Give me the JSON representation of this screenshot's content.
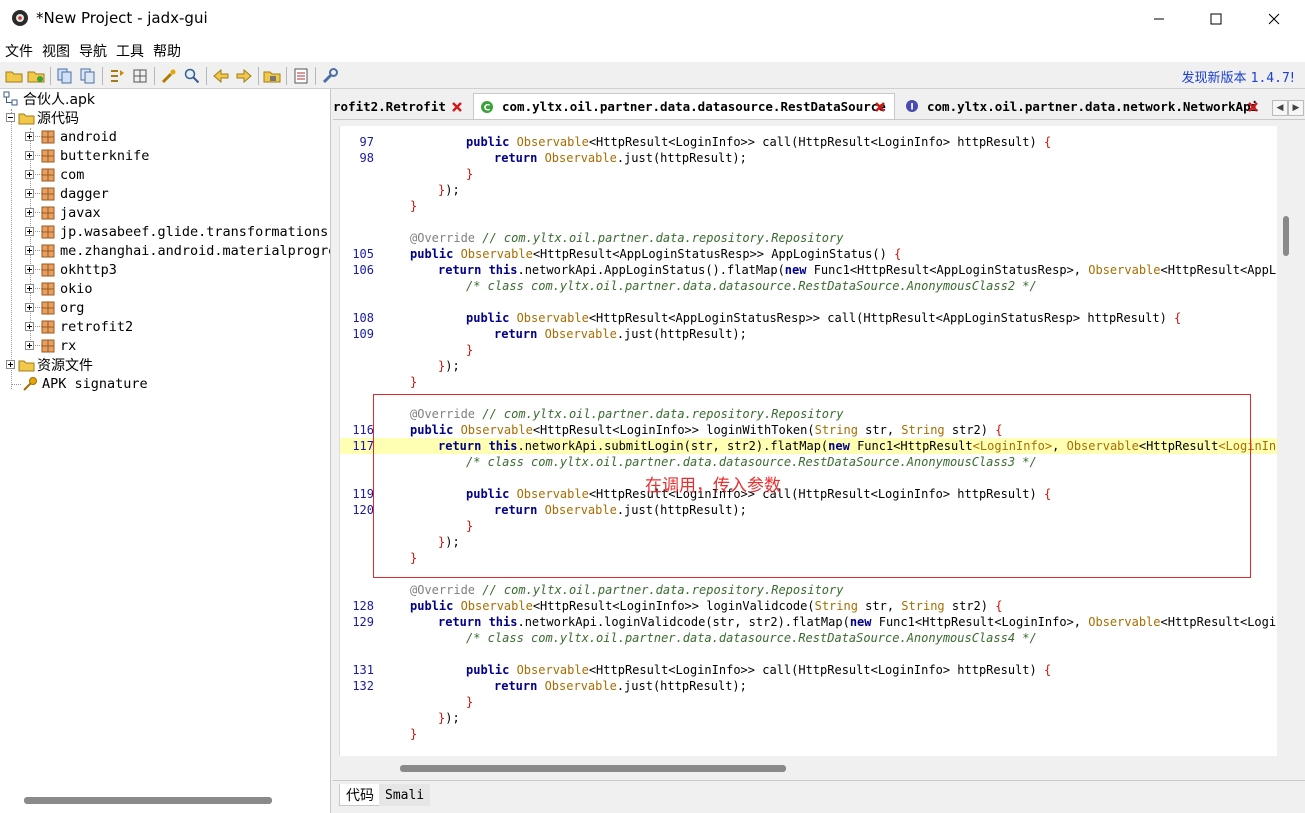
{
  "window": {
    "title": "*New Project - jadx-gui"
  },
  "menu": [
    "文件",
    "视图",
    "导航",
    "工具",
    "帮助"
  ],
  "toolbar": {
    "update_text": "发现新版本",
    "update_version": "1.4.7",
    "update_suffix": "!"
  },
  "tree": {
    "root": "合伙人.apk",
    "source_node": "源代码",
    "packages": [
      "android",
      "butterknife",
      "com",
      "dagger",
      "javax",
      "jp.wasabeef.glide.transformations",
      "me.zhanghai.android.materialprogre",
      "okhttp3",
      "okio",
      "org",
      "retrofit2",
      "rx"
    ],
    "resources_node": "资源文件",
    "signature_node": "APK signature"
  },
  "tabs": [
    {
      "label": "rofit2.Retrofit",
      "icon": "none"
    },
    {
      "label": "com.yltx.oil.partner.data.datasource.RestDataSource",
      "icon": "class-icon",
      "active": true
    },
    {
      "label": "com.yltx.oil.partner.data.network.NetworkApi",
      "icon": "interface-icon"
    }
  ],
  "code": [
    {
      "ln": "97",
      "indent": 3,
      "seg": [
        [
          "kw",
          "public "
        ],
        [
          "tp",
          "Observable"
        ],
        [
          "nm",
          "<HttpResult<LoginInfo>> call(HttpResult<LoginInfo> httpResult) "
        ],
        [
          "br",
          "{"
        ]
      ]
    },
    {
      "ln": "98",
      "indent": 4,
      "seg": [
        [
          "kw",
          "return "
        ],
        [
          "tp",
          "Observable"
        ],
        [
          "nm",
          ".just(httpResult);"
        ]
      ]
    },
    {
      "ln": "",
      "indent": 3,
      "seg": [
        [
          "br",
          "}"
        ]
      ]
    },
    {
      "ln": "",
      "indent": 2,
      "seg": [
        [
          "br",
          "}"
        ],
        [
          "nm",
          ");"
        ]
      ]
    },
    {
      "ln": "",
      "indent": 1,
      "seg": [
        [
          "br",
          "}"
        ]
      ]
    },
    {
      "ln": "",
      "indent": 0,
      "seg": []
    },
    {
      "ln": "",
      "indent": 1,
      "seg": [
        [
          "an",
          "@Override "
        ],
        [
          "cm",
          "// com.yltx.oil.partner.data.repository.Repository"
        ]
      ]
    },
    {
      "ln": "105",
      "indent": 1,
      "seg": [
        [
          "kw",
          "public "
        ],
        [
          "tp",
          "Observable"
        ],
        [
          "nm",
          "<HttpResult<AppLoginStatusResp>> AppLoginStatus() "
        ],
        [
          "br",
          "{"
        ]
      ]
    },
    {
      "ln": "106",
      "indent": 2,
      "seg": [
        [
          "kw",
          "return this"
        ],
        [
          "nm",
          ".networkApi.AppLoginStatus().flatMap("
        ],
        [
          "kw",
          "new "
        ],
        [
          "nm",
          "Func1<HttpResult<AppLoginStatusResp>, "
        ],
        [
          "tp",
          "Observable"
        ],
        [
          "nm",
          "<HttpResult<AppLogin"
        ]
      ]
    },
    {
      "ln": "",
      "indent": 3,
      "seg": [
        [
          "cm",
          "/* class com.yltx.oil.partner.data.datasource.RestDataSource.AnonymousClass2 */"
        ]
      ]
    },
    {
      "ln": "",
      "indent": 0,
      "seg": []
    },
    {
      "ln": "108",
      "indent": 3,
      "seg": [
        [
          "kw",
          "public "
        ],
        [
          "tp",
          "Observable"
        ],
        [
          "nm",
          "<HttpResult<AppLoginStatusResp>> call(HttpResult<AppLoginStatusResp> httpResult) "
        ],
        [
          "br",
          "{"
        ]
      ]
    },
    {
      "ln": "109",
      "indent": 4,
      "seg": [
        [
          "kw",
          "return "
        ],
        [
          "tp",
          "Observable"
        ],
        [
          "nm",
          ".just(httpResult);"
        ]
      ]
    },
    {
      "ln": "",
      "indent": 3,
      "seg": [
        [
          "br",
          "}"
        ]
      ]
    },
    {
      "ln": "",
      "indent": 2,
      "seg": [
        [
          "br",
          "}"
        ],
        [
          "nm",
          ");"
        ]
      ]
    },
    {
      "ln": "",
      "indent": 1,
      "seg": [
        [
          "br",
          "}"
        ]
      ]
    },
    {
      "ln": "",
      "indent": 0,
      "seg": []
    },
    {
      "ln": "",
      "indent": 1,
      "seg": [
        [
          "an",
          "@Override "
        ],
        [
          "cm",
          "// com.yltx.oil.partner.data.repository.Repository"
        ]
      ]
    },
    {
      "ln": "116",
      "indent": 1,
      "seg": [
        [
          "kw",
          "public "
        ],
        [
          "tp",
          "Observable"
        ],
        [
          "nm",
          "<HttpResult<LoginInfo>> loginWithToken("
        ],
        [
          "tp",
          "String "
        ],
        [
          "nm",
          "str, "
        ],
        [
          "tp",
          "String "
        ],
        [
          "nm",
          "str2) "
        ],
        [
          "br",
          "{"
        ]
      ]
    },
    {
      "ln": "117",
      "indent": 2,
      "hl": true,
      "seg": [
        [
          "kw",
          "return this"
        ],
        [
          "nm",
          ".networkApi.submitLogin(str, str2).flatMap("
        ],
        [
          "kw",
          "new "
        ],
        [
          "nm",
          "Func1<HttpResult"
        ],
        [
          "tp",
          "<LoginInfo>"
        ],
        [
          "nm",
          ", "
        ],
        [
          "tp",
          "Observable"
        ],
        [
          "nm",
          "<HttpResult"
        ],
        [
          "tp",
          "<LoginInfo>>"
        ]
      ]
    },
    {
      "ln": "",
      "indent": 3,
      "seg": [
        [
          "cm",
          "/* class com.yltx.oil.partner.data.datasource.RestDataSource.AnonymousClass3 */"
        ]
      ]
    },
    {
      "ln": "",
      "indent": 0,
      "seg": []
    },
    {
      "ln": "119",
      "indent": 3,
      "seg": [
        [
          "kw",
          "public "
        ],
        [
          "tp",
          "Observable"
        ],
        [
          "nm",
          "<HttpResult<LoginInfo>> call(HttpResult<LoginInfo> httpResult) "
        ],
        [
          "br",
          "{"
        ]
      ]
    },
    {
      "ln": "120",
      "indent": 4,
      "seg": [
        [
          "kw",
          "return "
        ],
        [
          "tp",
          "Observable"
        ],
        [
          "nm",
          ".just(httpResult);"
        ]
      ]
    },
    {
      "ln": "",
      "indent": 3,
      "seg": [
        [
          "br",
          "}"
        ]
      ]
    },
    {
      "ln": "",
      "indent": 2,
      "seg": [
        [
          "br",
          "}"
        ],
        [
          "nm",
          ");"
        ]
      ]
    },
    {
      "ln": "",
      "indent": 1,
      "seg": [
        [
          "br",
          "}"
        ]
      ]
    },
    {
      "ln": "",
      "indent": 0,
      "seg": []
    },
    {
      "ln": "",
      "indent": 1,
      "seg": [
        [
          "an",
          "@Override "
        ],
        [
          "cm",
          "// com.yltx.oil.partner.data.repository.Repository"
        ]
      ]
    },
    {
      "ln": "128",
      "indent": 1,
      "seg": [
        [
          "kw",
          "public "
        ],
        [
          "tp",
          "Observable"
        ],
        [
          "nm",
          "<HttpResult<LoginInfo>> loginValidcode("
        ],
        [
          "tp",
          "String "
        ],
        [
          "nm",
          "str, "
        ],
        [
          "tp",
          "String "
        ],
        [
          "nm",
          "str2) "
        ],
        [
          "br",
          "{"
        ]
      ]
    },
    {
      "ln": "129",
      "indent": 2,
      "seg": [
        [
          "kw",
          "return this"
        ],
        [
          "nm",
          ".networkApi.loginValidcode(str, str2).flatMap("
        ],
        [
          "kw",
          "new "
        ],
        [
          "nm",
          "Func1<HttpResult<LoginInfo>, "
        ],
        [
          "tp",
          "Observable"
        ],
        [
          "nm",
          "<HttpResult<LoginInf"
        ]
      ]
    },
    {
      "ln": "",
      "indent": 3,
      "seg": [
        [
          "cm",
          "/* class com.yltx.oil.partner.data.datasource.RestDataSource.AnonymousClass4 */"
        ]
      ]
    },
    {
      "ln": "",
      "indent": 0,
      "seg": []
    },
    {
      "ln": "131",
      "indent": 3,
      "seg": [
        [
          "kw",
          "public "
        ],
        [
          "tp",
          "Observable"
        ],
        [
          "nm",
          "<HttpResult<LoginInfo>> call(HttpResult<LoginInfo> httpResult) "
        ],
        [
          "br",
          "{"
        ]
      ]
    },
    {
      "ln": "132",
      "indent": 4,
      "seg": [
        [
          "kw",
          "return "
        ],
        [
          "tp",
          "Observable"
        ],
        [
          "nm",
          ".just(httpResult);"
        ]
      ]
    },
    {
      "ln": "",
      "indent": 3,
      "seg": [
        [
          "br",
          "}"
        ]
      ]
    },
    {
      "ln": "",
      "indent": 2,
      "seg": [
        [
          "br",
          "}"
        ],
        [
          "nm",
          ");"
        ]
      ]
    },
    {
      "ln": "",
      "indent": 1,
      "seg": [
        [
          "br",
          "}"
        ]
      ]
    }
  ],
  "annotation": "在调用，传入参数",
  "bottom_tabs": [
    "代码",
    "Smali"
  ],
  "colors": {
    "keyword": "#00008b",
    "type": "#a86d00",
    "comment": "#3a6b30",
    "brace": "#d01010",
    "highlight": "#ffffb4",
    "annotation_red": "#e0282d",
    "link_blue": "#1b3fd0"
  }
}
